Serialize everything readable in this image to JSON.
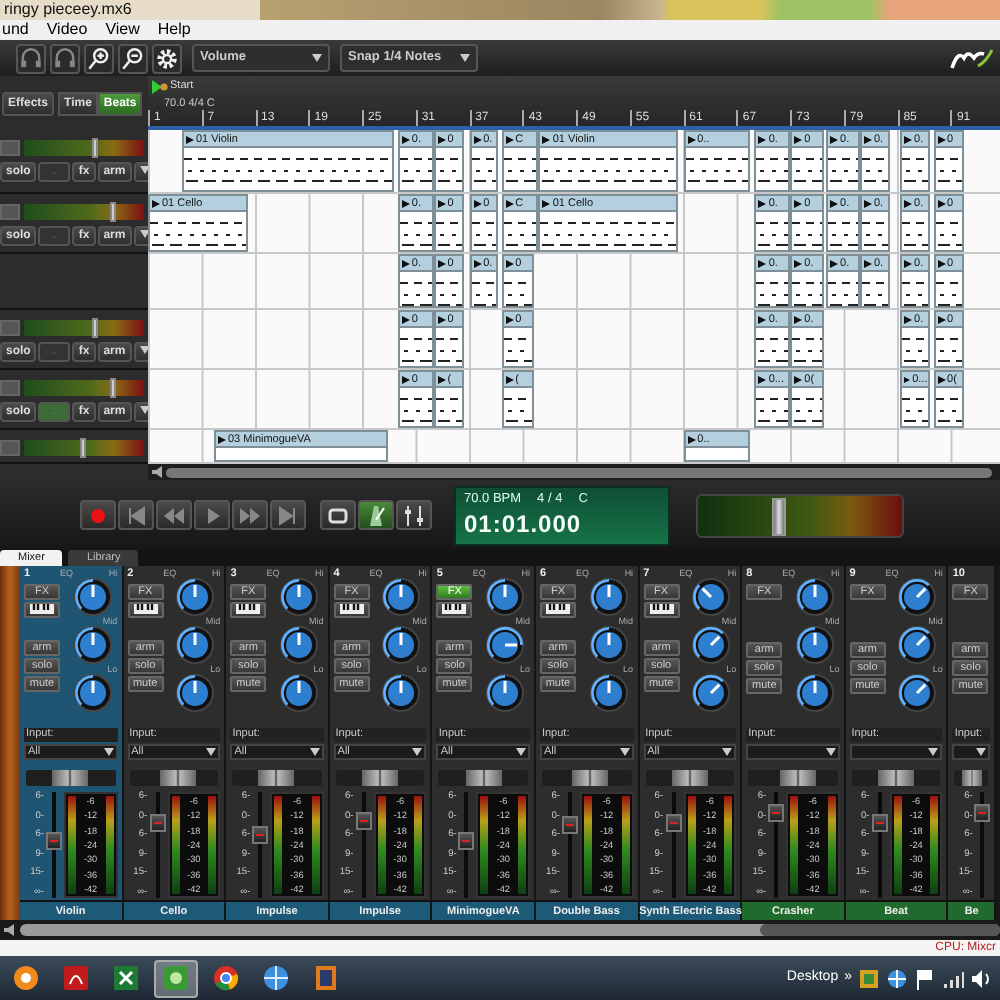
{
  "window": {
    "title": "ringy pieceey.mx6"
  },
  "menu": [
    "und",
    "Video",
    "View",
    "Help"
  ],
  "toolbar": {
    "icons": [
      {
        "kind": "headphones"
      },
      {
        "kind": "headphones"
      },
      {
        "kind": "zoom-in"
      },
      {
        "kind": "zoom-out"
      },
      {
        "kind": "settings"
      }
    ],
    "dropdowns": [
      {
        "value": "Volume"
      },
      {
        "value": "Snap 1/4 Notes"
      }
    ]
  },
  "track_panel": {
    "effects": "Effects",
    "toggle": [
      {
        "label": "Time",
        "selected": false
      },
      {
        "label": "Beats",
        "selected": true
      }
    ]
  },
  "ruler": {
    "marker": "Start",
    "tempo": "70.0 4/4 C",
    "bars": [
      "1",
      "7",
      "13",
      "19",
      "25",
      "31",
      "37",
      "43",
      "49",
      "55",
      "61",
      "67",
      "73",
      "79",
      "85",
      "91"
    ]
  },
  "tracks": [
    {
      "kind": "full",
      "volume": {
        "level": 0.6
      },
      "automation": false,
      "buttons": [
        "solo",
        "fx",
        "arm"
      ],
      "clips": [
        {
          "label": "01 Violin"
        },
        {
          "label": "0."
        },
        {
          "label": "0"
        },
        {
          "label": "0."
        },
        {
          "label": "C"
        },
        {
          "label": "01 Violin"
        },
        {
          "label": "0.."
        },
        {
          "label": "0."
        },
        {
          "label": "0"
        },
        {
          "label": "0."
        },
        {
          "label": "0."
        },
        {
          "label": "0."
        },
        {
          "label": "0"
        }
      ]
    },
    {
      "kind": "full",
      "volume": {
        "level": 0.75
      },
      "automation": false,
      "buttons": [
        "solo",
        "fx",
        "arm"
      ],
      "clips": [
        {
          "label": "01 Cello"
        },
        {
          "label": "0."
        },
        {
          "label": "0"
        },
        {
          "label": "0"
        },
        {
          "label": "C"
        },
        {
          "label": "01 Cello"
        },
        {
          "label": "0."
        },
        {
          "label": "0"
        },
        {
          "label": "0."
        },
        {
          "label": "0."
        },
        {
          "label": "0."
        },
        {
          "label": "0"
        }
      ]
    },
    {
      "kind": "empty",
      "clips": [
        {
          "label": "0."
        },
        {
          "label": "0"
        },
        {
          "label": "0."
        },
        {
          "label": "0"
        },
        {
          "label": "0."
        },
        {
          "label": "0."
        },
        {
          "label": "0."
        },
        {
          "label": "0."
        },
        {
          "label": "0."
        },
        {
          "label": "0"
        }
      ]
    },
    {
      "kind": "full",
      "volume": {
        "level": 0.6
      },
      "automation": false,
      "buttons": [
        "solo",
        "fx",
        "arm"
      ],
      "clips": [
        {
          "label": "0"
        },
        {
          "label": "0"
        },
        {
          "label": "0"
        },
        {
          "label": "0."
        },
        {
          "label": "0."
        },
        {
          "label": "0."
        },
        {
          "label": "0"
        }
      ]
    },
    {
      "kind": "full",
      "volume": {
        "level": 0.75
      },
      "automation": true,
      "buttons": [
        "solo",
        "fx",
        "arm"
      ],
      "clips": [
        {
          "label": "0"
        },
        {
          "label": "("
        },
        {
          "label": "("
        },
        {
          "label": "0..."
        },
        {
          "label": "0("
        },
        {
          "label": "0..."
        },
        {
          "label": "0("
        }
      ]
    },
    {
      "kind": "meter",
      "volume": {
        "level": 0.5
      },
      "clips": [
        {
          "label": "03 MinimogueVA"
        },
        {
          "label": "0.."
        }
      ]
    }
  ],
  "transport": {
    "buttons": [
      {
        "kind": "record",
        "on": false
      },
      {
        "kind": "to-start",
        "on": false
      },
      {
        "kind": "rewind",
        "on": false
      },
      {
        "kind": "play",
        "on": false
      },
      {
        "kind": "fast-forward",
        "on": false
      },
      {
        "kind": "to-end",
        "on": false
      },
      {
        "kind": "loop",
        "on": false
      },
      {
        "kind": "metronome",
        "on": true
      },
      {
        "kind": "mixer",
        "on": false
      }
    ],
    "display": {
      "tempo": "70.0 BPM",
      "meter": "4 / 4",
      "key": "C",
      "time": "01:01.000"
    },
    "master": {
      "level": 0.4
    }
  },
  "tabs": [
    {
      "label": "Mixer",
      "selected": true
    },
    {
      "label": "Library",
      "selected": false
    }
  ],
  "mixer": {
    "strips": [
      {
        "kind": "full",
        "number": "1",
        "selected": true,
        "fx": "FX",
        "fx_on": false,
        "piano": true,
        "eq": "EQ",
        "hi": "Hi",
        "mid": "Mid",
        "lo": "Lo",
        "knobs": [
          {
            "kind": "up"
          },
          {
            "kind": "up"
          },
          {
            "kind": "up"
          }
        ],
        "arm": "arm",
        "solo": "solo",
        "mute": "mute",
        "input_label": "Input:",
        "input": "All",
        "pan": {
          "level": 0.5
        },
        "fader": {
          "level": 0.55
        },
        "fader_scale": [
          "6-",
          "0-",
          "6-",
          "9-",
          "15-",
          "∞-"
        ],
        "meter_scale": [
          "-6",
          "-12",
          "-18",
          "-24",
          "-30",
          "-36",
          "-42"
        ],
        "name": "Violin",
        "color": "#1d5a78"
      },
      {
        "kind": "full",
        "number": "2",
        "selected": false,
        "fx": "FX",
        "fx_on": false,
        "piano": true,
        "eq": "EQ",
        "hi": "Hi",
        "mid": "Mid",
        "lo": "Lo",
        "knobs": [
          {
            "kind": "up"
          },
          {
            "kind": "up"
          },
          {
            "kind": "up"
          }
        ],
        "arm": "arm",
        "solo": "solo",
        "mute": "mute",
        "input_label": "Input:",
        "input": "All",
        "pan": {
          "level": 0.55
        },
        "fader": {
          "level": 0.75
        },
        "fader_scale": [
          "6-",
          "0-",
          "6-",
          "9-",
          "15-",
          "∞-"
        ],
        "meter_scale": [
          "-6",
          "-12",
          "-18",
          "-24",
          "-30",
          "-36",
          "-42"
        ],
        "name": "Cello",
        "color": "#1d5a78"
      },
      {
        "kind": "full",
        "number": "3",
        "selected": false,
        "fx": "FX",
        "fx_on": false,
        "piano": true,
        "eq": "EQ",
        "hi": "Hi",
        "mid": "Mid",
        "lo": "Lo",
        "knobs": [
          {
            "kind": "up"
          },
          {
            "kind": "up"
          },
          {
            "kind": "up"
          }
        ],
        "arm": "arm",
        "solo": "solo",
        "mute": "mute",
        "input_label": "Input:",
        "input": "All",
        "pan": {
          "level": 0.5
        },
        "fader": {
          "level": 0.62
        },
        "fader_scale": [
          "6-",
          "0-",
          "6-",
          "9-",
          "15-",
          "∞-"
        ],
        "meter_scale": [
          "-6",
          "-12",
          "-18",
          "-24",
          "-30",
          "-36",
          "-42"
        ],
        "name": "Impulse",
        "color": "#1d5a78"
      },
      {
        "kind": "full",
        "number": "4",
        "selected": false,
        "fx": "FX",
        "fx_on": false,
        "piano": true,
        "eq": "EQ",
        "hi": "Hi",
        "mid": "Mid",
        "lo": "Lo",
        "knobs": [
          {
            "kind": "up"
          },
          {
            "kind": "up"
          },
          {
            "kind": "up"
          }
        ],
        "arm": "arm",
        "solo": "solo",
        "mute": "mute",
        "input_label": "Input:",
        "input": "All",
        "pan": {
          "level": 0.5
        },
        "fader": {
          "level": 0.78
        },
        "fader_scale": [
          "6-",
          "0-",
          "6-",
          "9-",
          "15-",
          "∞-"
        ],
        "meter_scale": [
          "-6",
          "-12",
          "-18",
          "-24",
          "-30",
          "-36",
          "-42"
        ],
        "name": "Impulse",
        "color": "#1d5a78"
      },
      {
        "kind": "full",
        "number": "5",
        "selected": false,
        "fx": "FX",
        "fx_on": true,
        "piano": true,
        "eq": "EQ",
        "hi": "Hi",
        "mid": "Mid",
        "lo": "Lo",
        "knobs": [
          {
            "kind": "up"
          },
          {
            "kind": "right"
          },
          {
            "kind": "up"
          }
        ],
        "arm": "arm",
        "solo": "solo",
        "mute": "mute",
        "input_label": "Input:",
        "input": "All",
        "pan": {
          "level": 0.5
        },
        "fader": {
          "level": 0.55
        },
        "fader_scale": [
          "6-",
          "0-",
          "6-",
          "9-",
          "15-",
          "∞-"
        ],
        "meter_scale": [
          "-6",
          "-12",
          "-18",
          "-24",
          "-30",
          "-36",
          "-42"
        ],
        "name": "MinimogueVA",
        "color": "#1d5a78"
      },
      {
        "kind": "full",
        "number": "6",
        "selected": false,
        "fx": "FX",
        "fx_on": false,
        "piano": true,
        "eq": "EQ",
        "hi": "Hi",
        "mid": "Mid",
        "lo": "Lo",
        "knobs": [
          {
            "kind": "up"
          },
          {
            "kind": "up"
          },
          {
            "kind": "up"
          }
        ],
        "arm": "arm",
        "solo": "solo",
        "mute": "mute",
        "input_label": "Input:",
        "input": "All",
        "pan": {
          "level": 0.55
        },
        "fader": {
          "level": 0.73
        },
        "fader_scale": [
          "6-",
          "0-",
          "6-",
          "9-",
          "15-",
          "∞-"
        ],
        "meter_scale": [
          "-6",
          "-12",
          "-18",
          "-24",
          "-30",
          "-36",
          "-42"
        ],
        "name": "Double Bass",
        "color": "#1d5a78"
      },
      {
        "kind": "full",
        "number": "7",
        "selected": false,
        "fx": "FX",
        "fx_on": false,
        "piano": true,
        "eq": "EQ",
        "hi": "Hi",
        "mid": "Mid",
        "lo": "Lo",
        "knobs": [
          {
            "kind": "upleft"
          },
          {
            "kind": "upright"
          },
          {
            "kind": "upright"
          }
        ],
        "arm": "arm",
        "solo": "solo",
        "mute": "mute",
        "input_label": "Input:",
        "input": "All",
        "pan": {
          "level": 0.5
        },
        "fader": {
          "level": 0.76
        },
        "fader_scale": [
          "6-",
          "0-",
          "6-",
          "9-",
          "15-",
          "∞-"
        ],
        "meter_scale": [
          "-6",
          "-12",
          "-18",
          "-24",
          "-30",
          "-36",
          "-42"
        ],
        "name": "Synth Electric Bass",
        "color": "#1d5a78"
      },
      {
        "kind": "full",
        "number": "8",
        "selected": false,
        "fx": "FX",
        "fx_on": false,
        "piano": false,
        "eq": "EQ",
        "hi": "Hi",
        "mid": "Mid",
        "lo": "Lo",
        "knobs": [
          {
            "kind": "up"
          },
          {
            "kind": "up"
          },
          {
            "kind": "up"
          }
        ],
        "arm": "arm",
        "solo": "solo",
        "mute": "mute",
        "input_label": "Input:",
        "pan": {
          "level": 0.55
        },
        "fader": {
          "level": 0.86
        },
        "fader_scale": [
          "6-",
          "0-",
          "6-",
          "9-",
          "15-",
          "∞-"
        ],
        "meter_scale": [
          "-6",
          "-12",
          "-18",
          "-24",
          "-30",
          "-36",
          "-42"
        ],
        "name": "Crasher",
        "color": "#1f6a2c"
      },
      {
        "kind": "full",
        "number": "9",
        "selected": false,
        "fx": "FX",
        "fx_on": false,
        "piano": false,
        "eq": "EQ",
        "hi": "Hi",
        "mid": "Mid",
        "lo": "Lo",
        "knobs": [
          {
            "kind": "upright"
          },
          {
            "kind": "upright"
          },
          {
            "kind": "upright"
          }
        ],
        "arm": "arm",
        "solo": "solo",
        "mute": "mute",
        "input_label": "Input:",
        "pan": {
          "level": 0.5
        },
        "fader": {
          "level": 0.76
        },
        "fader_scale": [
          "6-",
          "0-",
          "6-",
          "9-",
          "15-",
          "∞-"
        ],
        "meter_scale": [
          "-6",
          "-12",
          "-18",
          "-24",
          "-30",
          "-36",
          "-42"
        ],
        "name": "Beat",
        "color": "#1f6a2c"
      },
      {
        "kind": "partial",
        "number": "10",
        "selected": false,
        "fx": "FX",
        "fx_on": false,
        "piano": false,
        "arm": "arm",
        "solo": "solo",
        "mute": "mute",
        "input_label": "Input:",
        "pan": {
          "level": 0.5
        },
        "fader": {
          "level": 0.86
        },
        "fader_scale": [
          "6-",
          "0-",
          "6-",
          "9-",
          "15-",
          "∞-"
        ],
        "name": "Be",
        "color": "#1f6a2c"
      }
    ]
  },
  "status_bar": {
    "text": "CPU: Mixcr"
  },
  "taskbar": {
    "apps": [
      {
        "kind": "media",
        "selected": false
      },
      {
        "kind": "pdf",
        "selected": false
      },
      {
        "kind": "spreadsheet",
        "selected": false
      },
      {
        "kind": "app",
        "selected": true
      },
      {
        "kind": "browser",
        "selected": false
      },
      {
        "kind": "globe",
        "selected": false
      },
      {
        "kind": "film",
        "selected": false
      }
    ],
    "desktop": "Desktop",
    "chevron": "»",
    "tray": [
      {
        "kind": "app"
      },
      {
        "kind": "globe"
      },
      {
        "kind": "flag"
      },
      {
        "kind": "signal"
      },
      {
        "kind": "volume"
      }
    ]
  }
}
